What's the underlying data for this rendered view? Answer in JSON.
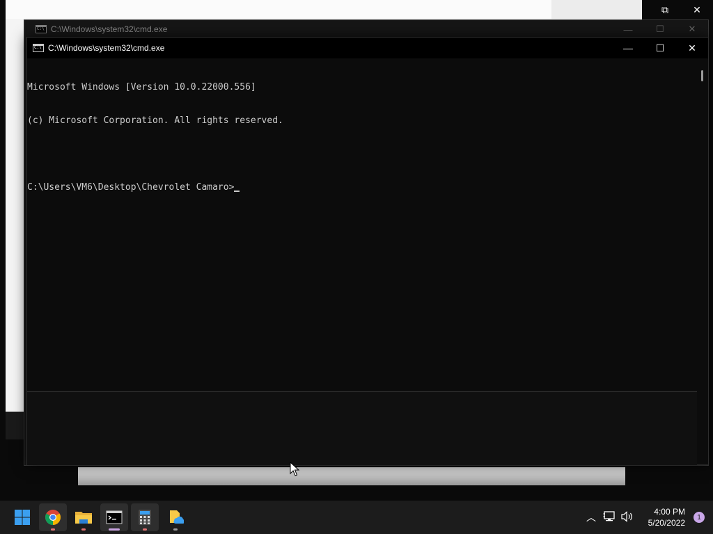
{
  "background_window": {
    "controls": {
      "restore_icon": "⧉",
      "close_icon": "✕"
    }
  },
  "back_cmd_window": {
    "title": "C:\\Windows\\system32\\cmd.exe",
    "controls": {
      "minimize": "—",
      "maximize": "☐",
      "close": "✕"
    }
  },
  "cmd_window": {
    "title": "C:\\Windows\\system32\\cmd.exe",
    "controls": {
      "minimize": "—",
      "maximize": "☐",
      "close": "✕"
    },
    "lines": [
      "Microsoft Windows [Version 10.0.22000.556]",
      "(c) Microsoft Corporation. All rights reserved.",
      "",
      "C:\\Users\\VM6\\Desktop\\Chevrolet Camaro>"
    ]
  },
  "taskbar": {
    "apps": [
      {
        "name": "start",
        "icon": "windows-logo-icon"
      },
      {
        "name": "chrome",
        "icon": "chrome-icon"
      },
      {
        "name": "file-explorer",
        "icon": "folder-icon"
      },
      {
        "name": "command-prompt",
        "icon": "terminal-icon"
      },
      {
        "name": "calculator",
        "icon": "calculator-icon"
      },
      {
        "name": "onedrive-files",
        "icon": "cloud-file-icon"
      }
    ],
    "tray": {
      "chevron": "︿",
      "network": "🖧",
      "volume": "🔊"
    },
    "clock": {
      "time": "4:00 PM",
      "date": "5/20/2022"
    },
    "notification_count": "1"
  },
  "colors": {
    "console_bg": "#0c0c0c",
    "console_text": "#cccccc",
    "taskbar_bg": "#1c1c1c",
    "windows_blue": "#3b9ff0"
  }
}
